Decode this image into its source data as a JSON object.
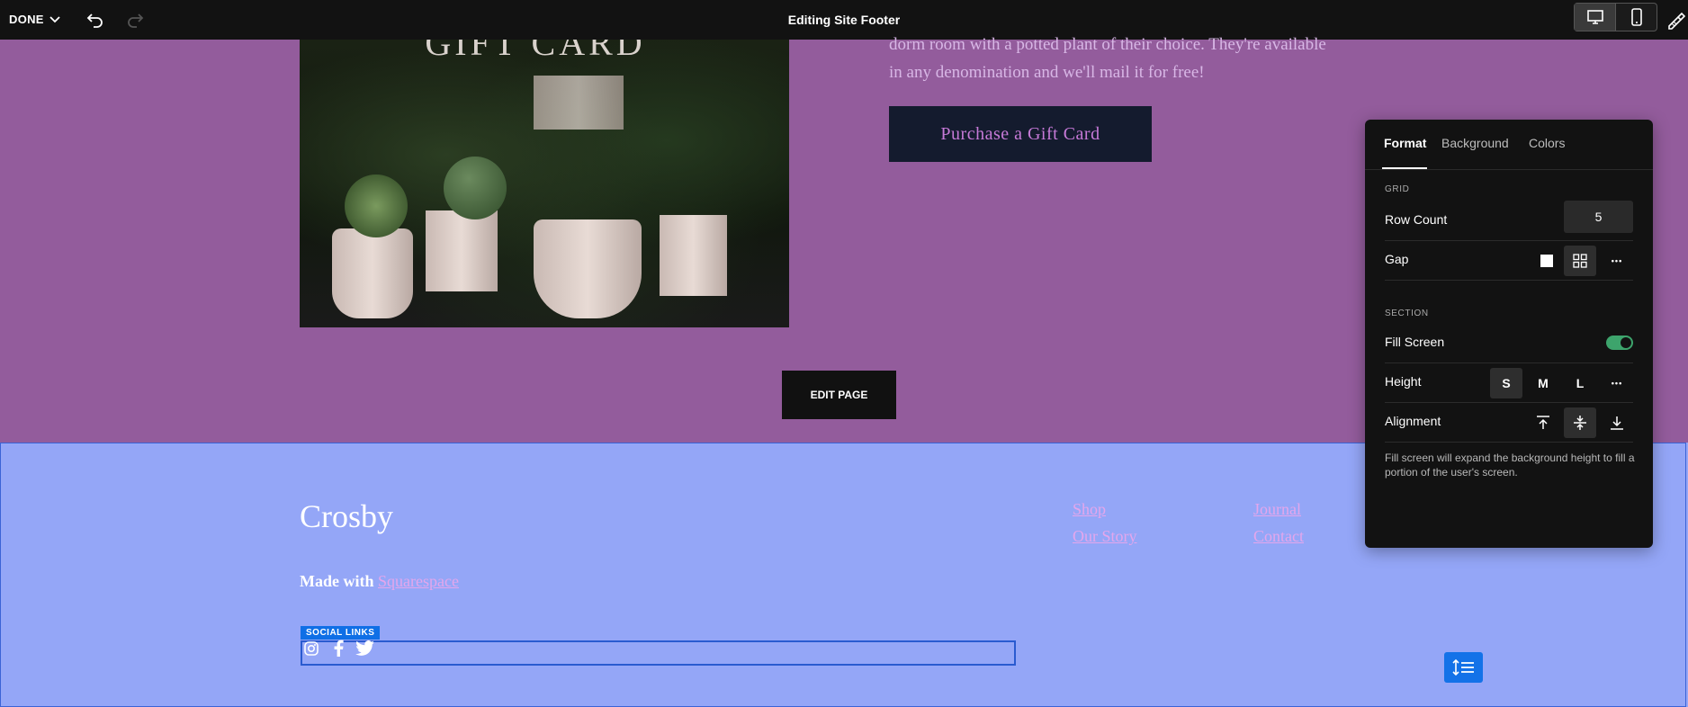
{
  "topbar": {
    "done_label": "DONE",
    "title": "Editing Site Footer",
    "icons": [
      "chevron-down-icon",
      "undo-icon",
      "redo-icon",
      "desktop-icon",
      "mobile-icon",
      "paint-brush-icon"
    ]
  },
  "hero": {
    "image_text": "GIFT CARD",
    "text_lines": [
      "dorm room with a potted plant of their choice. They're available",
      "in any denomination and we'll mail it for free!"
    ],
    "purchase_label": "Purchase a Gift Card",
    "edit_page_label": "EDIT PAGE"
  },
  "footer": {
    "logo": "Crosby",
    "made_with": "Made with",
    "made_with_link": "Squarespace",
    "nav": {
      "shop": "Shop",
      "our_story": "Our Story",
      "journal": "Journal",
      "contact": "Contact"
    },
    "social_label": "SOCIAL LINKS",
    "social_icons": [
      "instagram-icon",
      "facebook-icon",
      "twitter-icon"
    ]
  },
  "panel": {
    "tabs": {
      "format": "Format",
      "background": "Background",
      "colors": "Colors"
    },
    "grid_label": "GRID",
    "row_count_label": "Row Count",
    "row_count_value": "5",
    "gap_label": "Gap",
    "section_label": "SECTION",
    "fill_screen_label": "Fill Screen",
    "fill_screen_on": true,
    "height_label": "Height",
    "height_options": {
      "s": "S",
      "m": "M",
      "l": "L"
    },
    "height_selected": "S",
    "alignment_label": "Alignment",
    "help_text": "Fill screen will expand the background height to fill a portion of the user's screen.",
    "more_glyph": "•••"
  },
  "colors": {
    "hero_bg": "#935c9c",
    "footer_bg": "#94a6f7",
    "link": "#e4a6ec",
    "accent_blue": "#1372e8",
    "toggle_on": "#3da46c"
  }
}
